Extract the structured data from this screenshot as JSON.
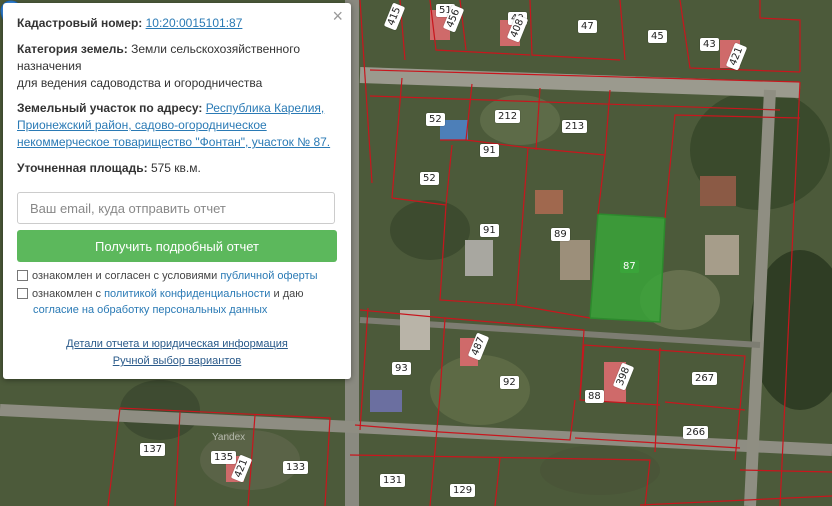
{
  "panel": {
    "cadastral_label": "Кадастровый номер:",
    "cadastral_value": "10:20:0015101:87",
    "category_label": "Категория земель:",
    "category_value": "Земли сельскохозяйственного назначения",
    "category_use": "для ведения садоводства и огородничества",
    "address_label": "Земельный участок по адресу:",
    "address_value": "Республика Карелия, Прионежский район, садово-огородническое некоммерческое товарищество \"Фонтан\", участок № 87.",
    "area_label": "Уточненная площадь:",
    "area_value": "575 кв.м.",
    "email_placeholder": "Ваш email, куда отправить отчет",
    "report_button": "Получить подробный отчет",
    "agree1_text": "ознакомлен и согласен с условиями",
    "agree1_link": "публичной оферты",
    "agree2_text": "ознакомлен с",
    "agree2_link": "политикой конфиденциальности",
    "agree2_tail": "и даю",
    "agree2_link2": "согласие на обработку персональных данных",
    "details_link": "Детали отчета и юридическая информация",
    "manual_link": "Ручной выбор вариантов",
    "close_glyph": "×"
  },
  "map": {
    "watermark": "Yandex",
    "selected_plot": "87",
    "plot_labels": [
      "51",
      "456",
      "49",
      "408",
      "47",
      "45",
      "43",
      "421",
      "415",
      "52",
      "212",
      "213",
      "91",
      "52",
      "91",
      "89",
      "87",
      "93",
      "487",
      "92",
      "88",
      "398",
      "267",
      "266",
      "137",
      "135",
      "421",
      "133",
      "131",
      "129"
    ],
    "selected_fill": "#3aa53a",
    "boundary_color": "#c8161d",
    "pin_color": "#3a8ee6"
  }
}
